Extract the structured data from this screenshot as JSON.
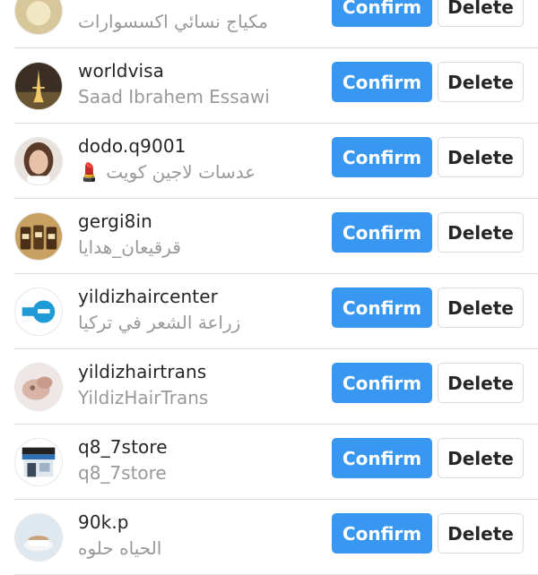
{
  "requests": [
    {
      "username": "",
      "full_name": "مكياج نسائي اكسسوارات",
      "full_name_rtl": true,
      "avatar": "avatar-icon"
    },
    {
      "username": "worldvisa",
      "full_name": "Saad Ibrahem Essawi",
      "full_name_rtl": false,
      "avatar": "eiffel-tower-icon"
    },
    {
      "username": "dodo.q9001",
      "full_name": "عدسات لاجين كويت 💄",
      "full_name_rtl": true,
      "avatar": "woman-portrait-icon"
    },
    {
      "username": "gergi8in",
      "full_name": "قرقيعان_هدايا",
      "full_name_rtl": true,
      "avatar": "gift-jars-icon"
    },
    {
      "username": "yildizhaircenter",
      "full_name": "زراعة الشعر في تركيا",
      "full_name_rtl": true,
      "avatar": "yildiz-hair-logo-icon"
    },
    {
      "username": "yildizhairtrans",
      "full_name": "YildizHairTrans",
      "full_name_rtl": false,
      "avatar": "hair-treatment-icon"
    },
    {
      "username": "q8_7store",
      "full_name": "q8_7store",
      "full_name_rtl": false,
      "avatar": "storefront-icon"
    },
    {
      "username": "90k.p",
      "full_name": "الحياه حلوه",
      "full_name_rtl": true,
      "avatar": "teacup-icon"
    }
  ],
  "labels": {
    "confirm": "Confirm",
    "delete": "Delete"
  },
  "colors": {
    "confirm_bg": "#3897f0",
    "separator": "#dbdbdb",
    "secondary_text": "#999999"
  }
}
